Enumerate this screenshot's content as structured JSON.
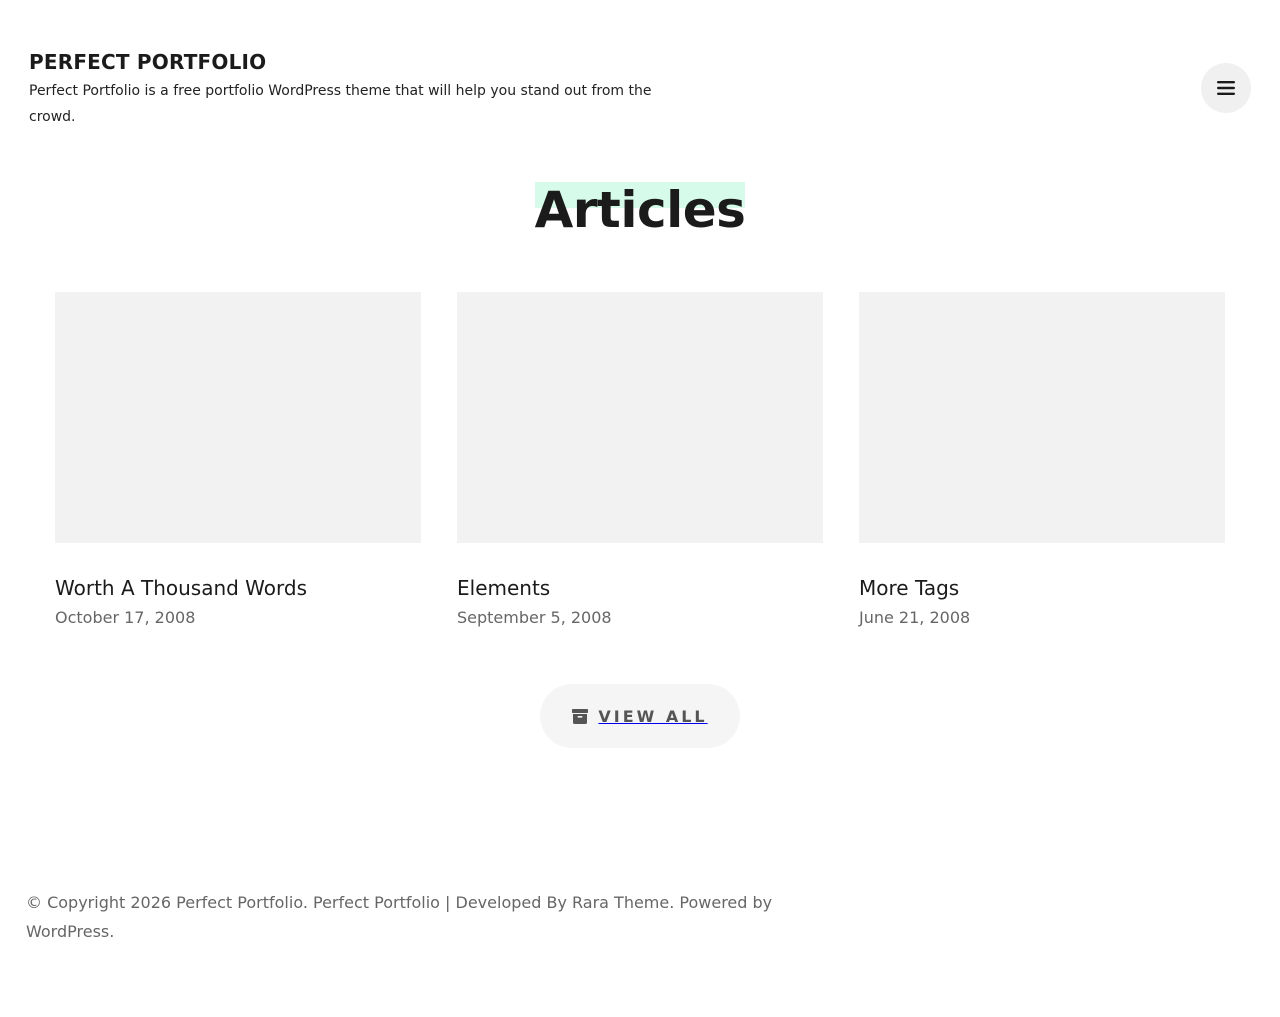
{
  "header": {
    "site_title": "PERFECT PORTFOLIO",
    "site_description": "Perfect Portfolio is a free portfolio WordPress theme that will help you stand out from the crowd.",
    "menu_icon": "hamburger-menu-icon"
  },
  "section": {
    "heading": "Articles",
    "highlight_color": "#d6fbea"
  },
  "articles": [
    {
      "title": "Worth A Thousand Words",
      "date": "October 17, 2008"
    },
    {
      "title": "Elements",
      "date": "September 5, 2008"
    },
    {
      "title": "More Tags",
      "date": "June 21, 2008"
    }
  ],
  "view_all": {
    "label": "VIEW ALL",
    "icon": "archive-icon"
  },
  "footer": {
    "copyright_prefix": "© Copyright 2026 ",
    "site_link": "Perfect Portfolio",
    "after_site": ". Perfect Portfolio | Developed By ",
    "developer_link": "Rara Theme",
    "after_developer": ". Powered by ",
    "wordpress_link": "WordPress",
    "suffix": "."
  }
}
